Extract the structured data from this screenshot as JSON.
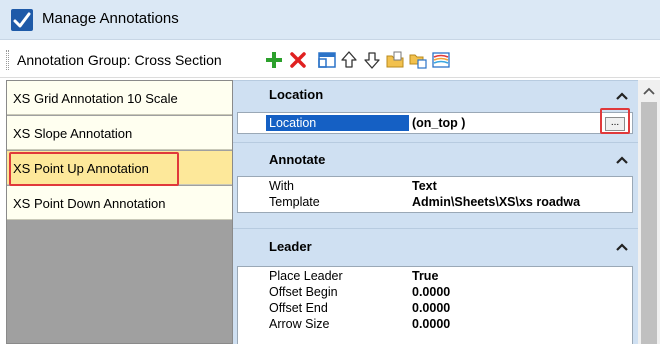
{
  "window": {
    "title": "Manage Annotations"
  },
  "toolbar": {
    "group_label": "Annotation Group: Cross Section",
    "icons": [
      "add-icon",
      "delete-icon",
      "new-window-icon",
      "move-up-icon",
      "move-down-icon",
      "folder-icon",
      "open-icon",
      "gradient-icon"
    ]
  },
  "annotations": [
    {
      "label": "XS Grid Annotation 10 Scale"
    },
    {
      "label": "XS Slope Annotation"
    },
    {
      "label": "XS Point Up Annotation"
    },
    {
      "label": "XS Point Down Annotation"
    }
  ],
  "selected_annotation": "XS Point Up Annotation",
  "sections": {
    "location": {
      "title": "Location",
      "props": [
        {
          "name": "Location",
          "value": "(on_top )",
          "button": "..."
        }
      ]
    },
    "annotate": {
      "title": "Annotate",
      "props": [
        {
          "name": "With",
          "value": "Text"
        },
        {
          "name": "Template",
          "value": "Admin\\Sheets\\XS\\xs roadwa"
        }
      ]
    },
    "leader": {
      "title": "Leader",
      "props": [
        {
          "name": "Place Leader",
          "value": "True"
        },
        {
          "name": "Offset Begin",
          "value": "0.0000"
        },
        {
          "name": "Offset End",
          "value": "0.0000"
        },
        {
          "name": "Arrow Size",
          "value": "0.0000"
        }
      ]
    }
  },
  "colors": {
    "title_bar": "#dbe8f5",
    "section_header": "#cfe0f2",
    "list_item": "#fffff0",
    "selected_item": "#fde89a",
    "selected_property": "#1560c4",
    "highlight_box": "#e0393b",
    "add_icon": "#2ca02c",
    "delete_icon": "#e02020"
  }
}
